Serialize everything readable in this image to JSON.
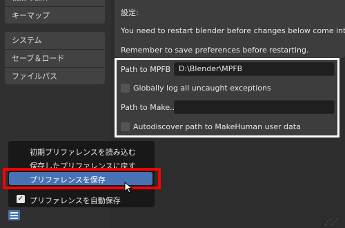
{
  "sidebar": {
    "group1": [
      {
        "label": "視点の操作"
      },
      {
        "label": "キーマップ"
      }
    ],
    "group2": [
      {
        "label": "システム"
      },
      {
        "label": "セーブ＆ロード"
      },
      {
        "label": "ファイルパス"
      }
    ]
  },
  "settings": {
    "title": "設定:",
    "restart_note": "You need to restart blender before changes below come into ...",
    "save_note": "Remember to save preferences before restarting."
  },
  "mpfb": {
    "path_label": "Path to MPFB ...",
    "path_value": "D:\\Blender\\MPFB",
    "log_label": "Globally log all uncaught exceptions",
    "makehuman_label": "Path to Make...",
    "makehuman_value": "",
    "autodiscover_label": "Autodiscover path to MakeHuman user data"
  },
  "menu": {
    "items": [
      {
        "label": "初期プリファレンスを読み込む"
      },
      {
        "label": "保存したプリファレンスに戻す"
      },
      {
        "label": "プリファレンスを保存"
      },
      {
        "label": "プリファレンスを自動保存"
      }
    ],
    "auto_save_checked": "✓"
  },
  "icons": {
    "menu": "hamburger-menu-icon",
    "cursor": "mouse-pointer-icon",
    "resize": "resize-grip-icon"
  },
  "colors": {
    "accent": "#4772b3",
    "highlight_red": "#ff0000",
    "panel": "#3d3d3d",
    "background": "#303030"
  }
}
